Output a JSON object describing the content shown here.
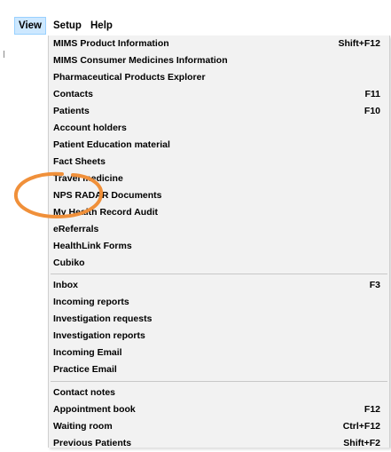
{
  "menubar": {
    "items": [
      {
        "label": "View",
        "active": true
      },
      {
        "label": "Setup",
        "active": false
      },
      {
        "label": "Help",
        "active": false
      }
    ]
  },
  "view_menu": {
    "groups": [
      [
        {
          "label": "MIMS Product Information",
          "shortcut": "Shift+F12"
        },
        {
          "label": "MIMS Consumer Medicines Information",
          "shortcut": ""
        },
        {
          "label": "Pharmaceutical Products Explorer",
          "shortcut": ""
        },
        {
          "label": "Contacts",
          "shortcut": "F11"
        },
        {
          "label": "Patients",
          "shortcut": "F10"
        },
        {
          "label": "Account holders",
          "shortcut": ""
        },
        {
          "label": "Patient Education material",
          "shortcut": ""
        },
        {
          "label": "Fact Sheets",
          "shortcut": ""
        },
        {
          "label": "Travel medicine",
          "shortcut": ""
        },
        {
          "label": "NPS RADAR Documents",
          "shortcut": ""
        },
        {
          "label": "My Health Record Audit",
          "shortcut": ""
        },
        {
          "label": "eReferrals",
          "shortcut": ""
        },
        {
          "label": "HealthLink Forms",
          "shortcut": ""
        },
        {
          "label": "Cubiko",
          "shortcut": ""
        }
      ],
      [
        {
          "label": "Inbox",
          "shortcut": "F3"
        },
        {
          "label": "Incoming reports",
          "shortcut": ""
        },
        {
          "label": "Investigation requests",
          "shortcut": ""
        },
        {
          "label": "Investigation reports",
          "shortcut": ""
        },
        {
          "label": "Incoming Email",
          "shortcut": ""
        },
        {
          "label": "Practice Email",
          "shortcut": ""
        }
      ],
      [
        {
          "label": "Contact notes",
          "shortcut": ""
        },
        {
          "label": "Appointment book",
          "shortcut": "F12"
        },
        {
          "label": "Waiting room",
          "shortcut": "Ctrl+F12"
        },
        {
          "label": "Previous Patients",
          "shortcut": "Shift+F2"
        }
      ]
    ]
  },
  "highlight": {
    "target": "eReferrals",
    "color": "#f0903a"
  }
}
